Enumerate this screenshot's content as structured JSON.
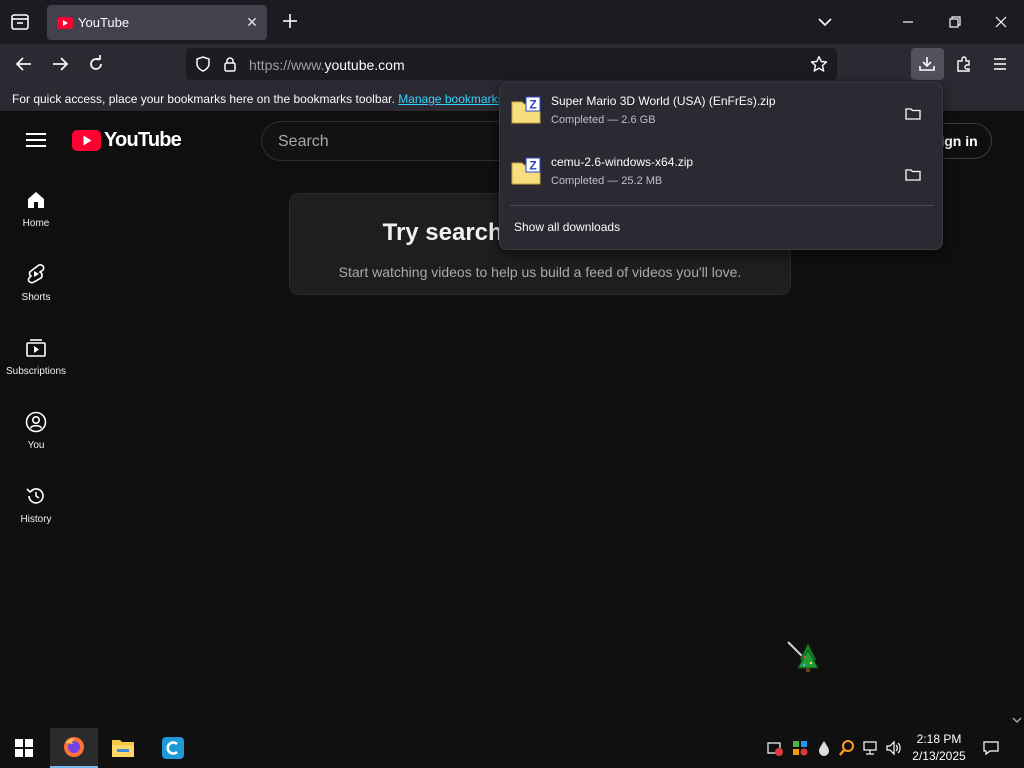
{
  "browser": {
    "tab": {
      "title": "YouTube"
    },
    "url": {
      "prefix": "https://www.",
      "host": "youtube.com"
    },
    "bookmarks_bar": {
      "message": "For quick access, place your bookmarks here on the bookmarks toolbar. ",
      "link": "Manage bookmarks"
    }
  },
  "youtube": {
    "logo_text": "YouTube",
    "search_placeholder": "Search",
    "sign_in": "Sign in",
    "nav": [
      {
        "label": "Home",
        "icon": "home-icon"
      },
      {
        "label": "Shorts",
        "icon": "shorts-icon"
      },
      {
        "label": "Subscriptions",
        "icon": "subscriptions-icon"
      },
      {
        "label": "You",
        "icon": "you-icon"
      },
      {
        "label": "History",
        "icon": "history-icon"
      }
    ],
    "empty_card": {
      "title": "Try searching to get started",
      "subtitle": "Start watching videos to help us build a feed of videos you'll love."
    },
    "colors": {
      "brand_red": "#ff0033",
      "background": "#0f0f0f"
    }
  },
  "downloads": {
    "items": [
      {
        "name": "Super Mario 3D World (USA) (EnFrEs).zip",
        "status": "Completed — 2.6 GB"
      },
      {
        "name": "cemu-2.6-windows-x64.zip",
        "status": "Completed — 25.2 MB"
      }
    ],
    "show_all": "Show all downloads"
  },
  "taskbar": {
    "apps": [
      "firefox-icon",
      "file-explorer-icon",
      "ccleaner-icon"
    ],
    "time": "2:18 PM",
    "date": "2/13/2025"
  }
}
